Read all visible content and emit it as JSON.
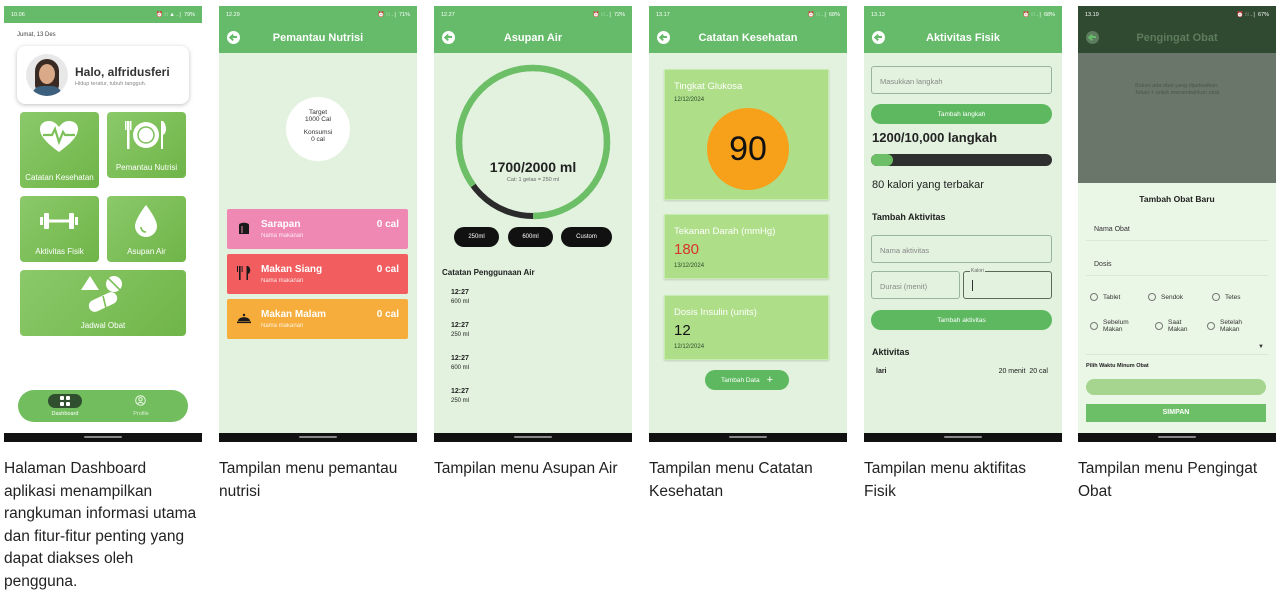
{
  "screens": {
    "dashboard": {
      "status_time": "10.06",
      "status_icons": "⏰ ∷ ▲ .❘ 79%",
      "date": "Jumat, 13 Des",
      "greeting": "Halo, alfridusferi",
      "subgreeting": "Hidup teratur, tubuh tangguh.",
      "tiles": [
        "Catatan Kesehatan",
        "Pemantau Nutrisi",
        "Aktivitas Fisik",
        "Asupan Air",
        "Jadwal Obat"
      ],
      "nav": [
        "Dashboard",
        "Profile"
      ],
      "caption": "Halaman Dashboard aplikasi menampilkan rangkuman informasi utama dan fitur-fitur penting yang dapat diakses oleh pengguna."
    },
    "nutrisi": {
      "status_time": "12.29",
      "status_icons": "⏰ ∷ .❘ 71%",
      "title": "Pemantau Nutrisi",
      "target_label": "Target",
      "target_value": "1000 Cal",
      "konsumsi_label": "Konsumsi",
      "konsumsi_value": "0 cal",
      "meals": [
        {
          "name": "Sarapan",
          "sub": "Nama makanan",
          "value": "0 cal",
          "color": "#f088b4"
        },
        {
          "name": "Makan Siang",
          "sub": "Nama makanan",
          "value": "0 cal",
          "color": "#f25e60"
        },
        {
          "name": "Makan Malam",
          "sub": "Nama makanan",
          "value": "0 cal",
          "color": "#f6ad3b"
        }
      ],
      "caption": "Tampilan menu pemantau nutrisi"
    },
    "air": {
      "status_time": "12.27",
      "status_icons": "⏰ ∷ .❘ 72%",
      "title": "Asupan Air",
      "progress_text": "1700/2000 ml",
      "progress_fraction": 0.85,
      "note": "Cat: 1 gelas = 250 ml",
      "buttons": [
        "250ml",
        "600ml",
        "Custom"
      ],
      "log_title": "Catatan Penggunaan Air",
      "logs": [
        {
          "time": "12:27",
          "amount": "600 ml"
        },
        {
          "time": "12:27",
          "amount": "250 ml"
        },
        {
          "time": "12:27",
          "amount": "600 ml"
        },
        {
          "time": "12:27",
          "amount": "250 ml"
        }
      ],
      "caption": "Tampilan menu Asupan Air"
    },
    "kesehatan": {
      "status_time": "13.17",
      "status_icons": "⏰ ∷ .❘ 68%",
      "title": "Catatan Kesehatan",
      "glukosa_label": "Tingkat Glukosa",
      "glukosa_date": "12/12/2024",
      "glukosa_value": "90",
      "tekanan_label": "Tekanan Darah (mmHg)",
      "tekanan_value": "180",
      "tekanan_date": "13/12/2024",
      "insulin_label": "Dosis Insulin (units)",
      "insulin_value": "12",
      "insulin_date": "12/12/2024",
      "add_button": "Tambah Data",
      "caption": "Tampilan menu Catatan Kesehatan"
    },
    "fisik": {
      "status_time": "13.13",
      "status_icons": "⏰ ∷ .❘ 68%",
      "title": "Aktivitas Fisik",
      "steps_placeholder": "Masukkan langkah",
      "add_steps": "Tambah langkah",
      "steps_text": "1200/10,000 langkah",
      "steps_fraction": 0.12,
      "calories_text": "80 kalori yang terbakar",
      "section_title": "Tambah Aktivitas",
      "activity_placeholder": "Nama aktivitas",
      "duration_placeholder": "Durasi (menit)",
      "calorie_label": "Kalori",
      "add_activity": "Tambah aktivitas",
      "list_title": "Aktivitas",
      "activity_name": "lari",
      "activity_duration": "20 menit",
      "activity_cal": "20 cal",
      "caption": "Tampilan menu aktifitas Fisik"
    },
    "obat": {
      "status_time": "13.19",
      "status_icons": "⏰ ∷ .❘ 67%",
      "title": "Pengingat Obat",
      "empty_text_1": "Belum ada obat yang dijadwalkan.",
      "empty_text_2": "Tekan + untuk menambahkan obat",
      "dialog_title": "Tambah Obat Baru",
      "name_placeholder": "Nama Obat",
      "dose_placeholder": "Dosis",
      "options_row1": [
        "Tablet",
        "Sendok",
        "Tetes"
      ],
      "options_row2": [
        [
          "Sebelum",
          "Makan"
        ],
        [
          "Saat",
          "Makan"
        ],
        [
          "Setelah",
          "Makan"
        ]
      ],
      "time_label": "Pilih Waktu Minum Obat",
      "save": "SIMPAN",
      "caption": "Tampilan menu Pengingat Obat"
    }
  },
  "colors": {
    "primary": "#66bb6a",
    "background": "#e2f2de",
    "glucose_circle": "#f7a01a",
    "pressure_value": "#d9342b"
  }
}
